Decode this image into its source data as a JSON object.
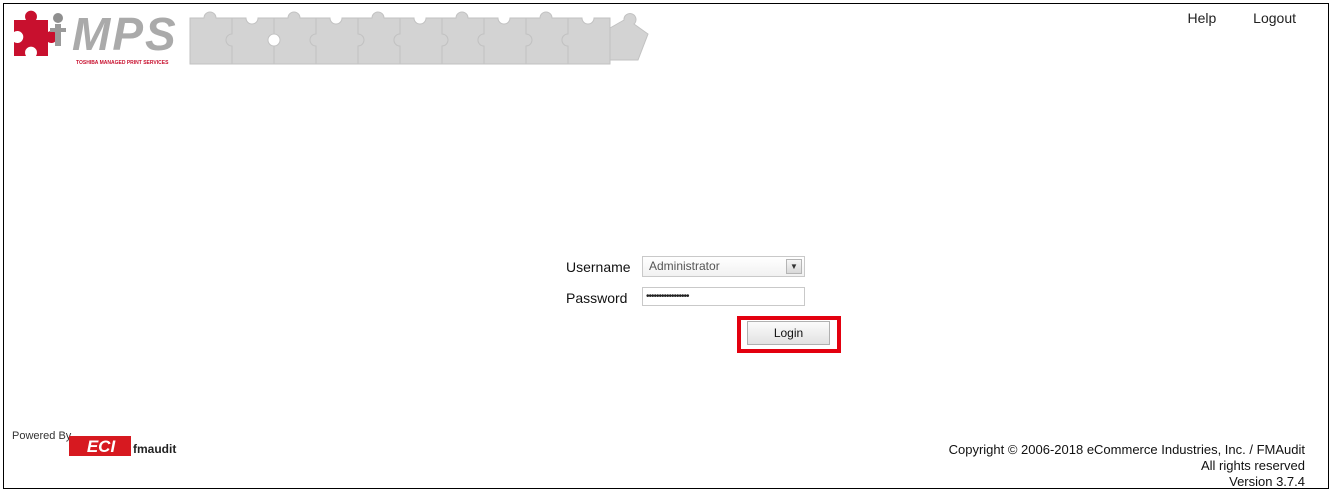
{
  "header": {
    "brand": "MPS",
    "brand_tagline": "TOSHIBA MANAGED PRINT SERVICES",
    "links": {
      "help": "Help",
      "logout": "Logout"
    }
  },
  "login": {
    "username_label": "Username",
    "username_value": "Administrator",
    "password_label": "Password",
    "password_mask": "•••••••••••••••••",
    "login_button": "Login"
  },
  "footer": {
    "powered_by": "Powered By",
    "eci": "ECI",
    "fmaudit": "fmaudit",
    "copyright": "Copyright © 2006-2018 eCommerce Industries, Inc. / FMAudit",
    "rights": "All rights reserved",
    "version": "Version 3.7.4"
  },
  "colors": {
    "brand_red": "#c8102e",
    "puzzle_gray": "#cfcfcf",
    "highlight": "#e3000f"
  }
}
